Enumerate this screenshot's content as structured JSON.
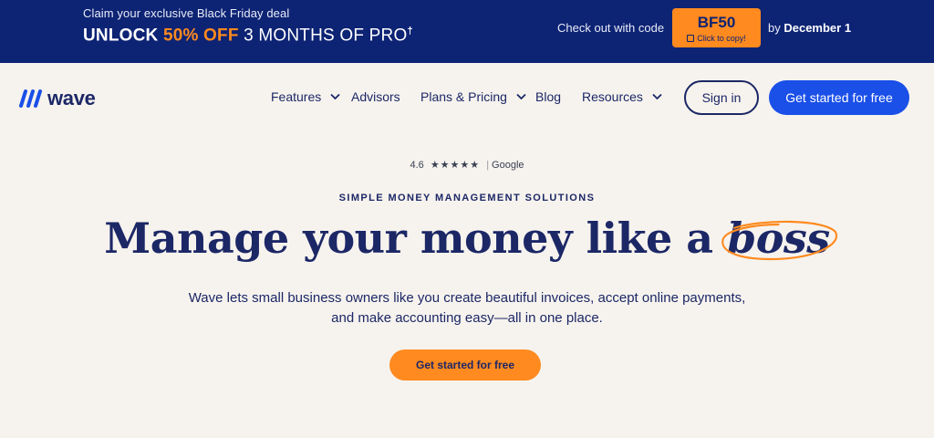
{
  "promo": {
    "tagline": "Claim your exclusive Black Friday deal",
    "headline_prefix": "UNLOCK ",
    "headline_highlight": "50% OFF",
    "headline_rest": " 3 MONTHS OF PRO",
    "headline_mark": "†",
    "code_label": "Check out with code",
    "code": "BF50",
    "code_hint": "Click to copy!",
    "deadline_prefix": "by ",
    "deadline": "December 1"
  },
  "nav": {
    "brand": "wave",
    "items": [
      {
        "label": "Features",
        "has_dropdown": true
      },
      {
        "label": "Advisors",
        "has_dropdown": false
      },
      {
        "label": "Plans & Pricing",
        "has_dropdown": true
      },
      {
        "label": "Blog",
        "has_dropdown": false
      },
      {
        "label": "Resources",
        "has_dropdown": true
      }
    ],
    "signin_label": "Sign in",
    "cta_label": "Get started for free"
  },
  "hero": {
    "rating_score": "4.6",
    "rating_stars": "★★★★★",
    "rating_sep": "|",
    "rating_source": "Google",
    "eyebrow": "SIMPLE MONEY MANAGEMENT SOLUTIONS",
    "headline": "Manage your money like a ",
    "headline_emphasis": "boss",
    "subtext_line1": "Wave lets small business owners like you create beautiful invoices, accept online payments,",
    "subtext_line2": "and make accounting easy—all in one place.",
    "cta_label": "Get started for free"
  },
  "colors": {
    "banner_bg": "#0d2374",
    "accent_orange": "#ff8a1f",
    "primary_blue": "#1a4fe8",
    "navy_text": "#1c2766",
    "page_bg": "#f6f3ee"
  },
  "icons": [
    "wave-logo-icon",
    "chevron-down-icon",
    "copy-icon",
    "star-icon"
  ]
}
